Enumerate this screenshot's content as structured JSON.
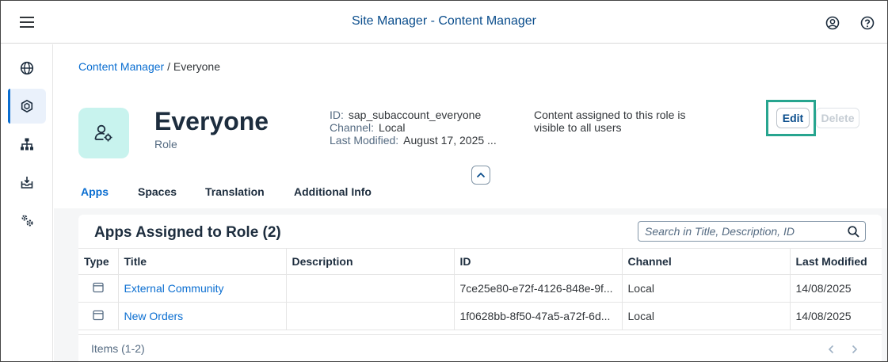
{
  "shell": {
    "title": "Site Manager - Content Manager",
    "menu_icon": "hamburger-icon",
    "user_icon": "user-account-icon",
    "help_icon": "help-icon"
  },
  "sidebar": {
    "items": [
      {
        "name": "globe-icon",
        "active": false
      },
      {
        "name": "content-manager-icon",
        "active": true
      },
      {
        "name": "hierarchy-icon",
        "active": false
      },
      {
        "name": "inbox-download-icon",
        "active": false
      },
      {
        "name": "settings-gears-icon",
        "active": false
      }
    ]
  },
  "breadcrumb": {
    "parent": "Content Manager",
    "separator": " / ",
    "current": "Everyone"
  },
  "header": {
    "title": "Everyone",
    "subtitle": "Role",
    "id_label": "ID:",
    "id_value": "sap_subaccount_everyone",
    "channel_label": "Channel:",
    "channel_value": "Local",
    "modified_label": "Last Modified:",
    "modified_value": "August 17, 2025 ...",
    "description": "Content assigned to this role is visible to all users",
    "edit_label": "Edit",
    "delete_label": "Delete",
    "accent_color": "#27a58f"
  },
  "tabs": [
    "Apps",
    "Spaces",
    "Translation",
    "Additional Info"
  ],
  "apps": {
    "title": "Apps Assigned to Role (2)",
    "search_placeholder": "Search in Title, Description, ID",
    "columns": [
      "Type",
      "Title",
      "Description",
      "ID",
      "Channel",
      "Last Modified"
    ],
    "rows": [
      {
        "type_icon": "app-window-icon",
        "title": "External Community",
        "description": "",
        "id": "7ce25e80-e72f-4126-848e-9f...",
        "channel": "Local",
        "last_modified": "14/08/2025"
      },
      {
        "type_icon": "app-window-icon",
        "title": "New Orders",
        "description": "",
        "id": "1f0628bb-8f50-47a5-a72f-6d...",
        "channel": "Local",
        "last_modified": "14/08/2025"
      }
    ],
    "items_count": "Items (1-2)"
  }
}
